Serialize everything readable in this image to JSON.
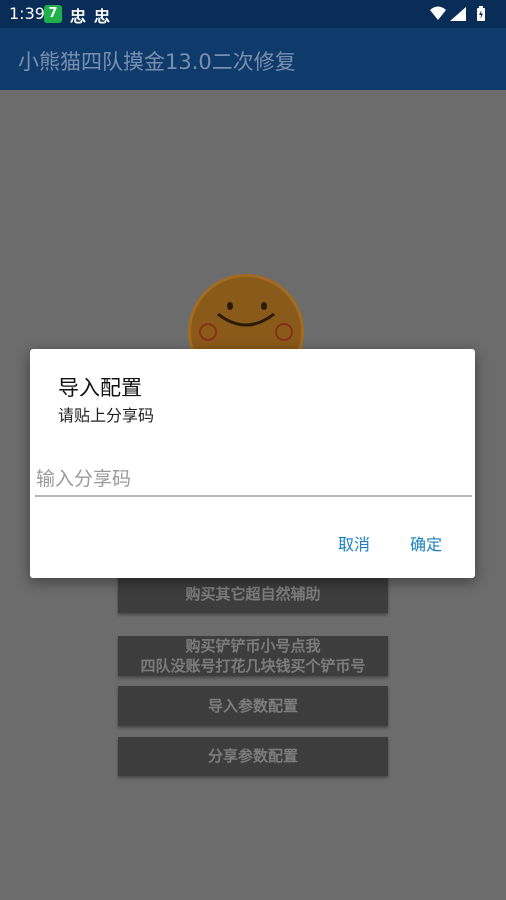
{
  "status_bar": {
    "time": "1:39",
    "notification_badge": "7",
    "bug_icon_1": "忠",
    "bug_icon_2": "忠"
  },
  "app_bar": {
    "title": "小熊猫四队摸金13.0二次修复"
  },
  "background_buttons": [
    {
      "label": "购买其它超自然辅助"
    },
    {
      "label_line1": "购买铲铲币小号点我",
      "label_line2": "四队没账号打花几块钱买个铲币号"
    },
    {
      "label": "导入参数配置"
    },
    {
      "label": "分享参数配置"
    }
  ],
  "dialog": {
    "title": "导入配置",
    "message": "请贴上分享码",
    "input": {
      "placeholder": "输入分享码",
      "value": ""
    },
    "cancel_label": "取消",
    "confirm_label": "确定"
  },
  "colors": {
    "status_bar": "#0a2d57",
    "app_bar": "#0e3a6c",
    "scrim": "#6c6c6c",
    "dialog_button": "#1a7fbf"
  }
}
